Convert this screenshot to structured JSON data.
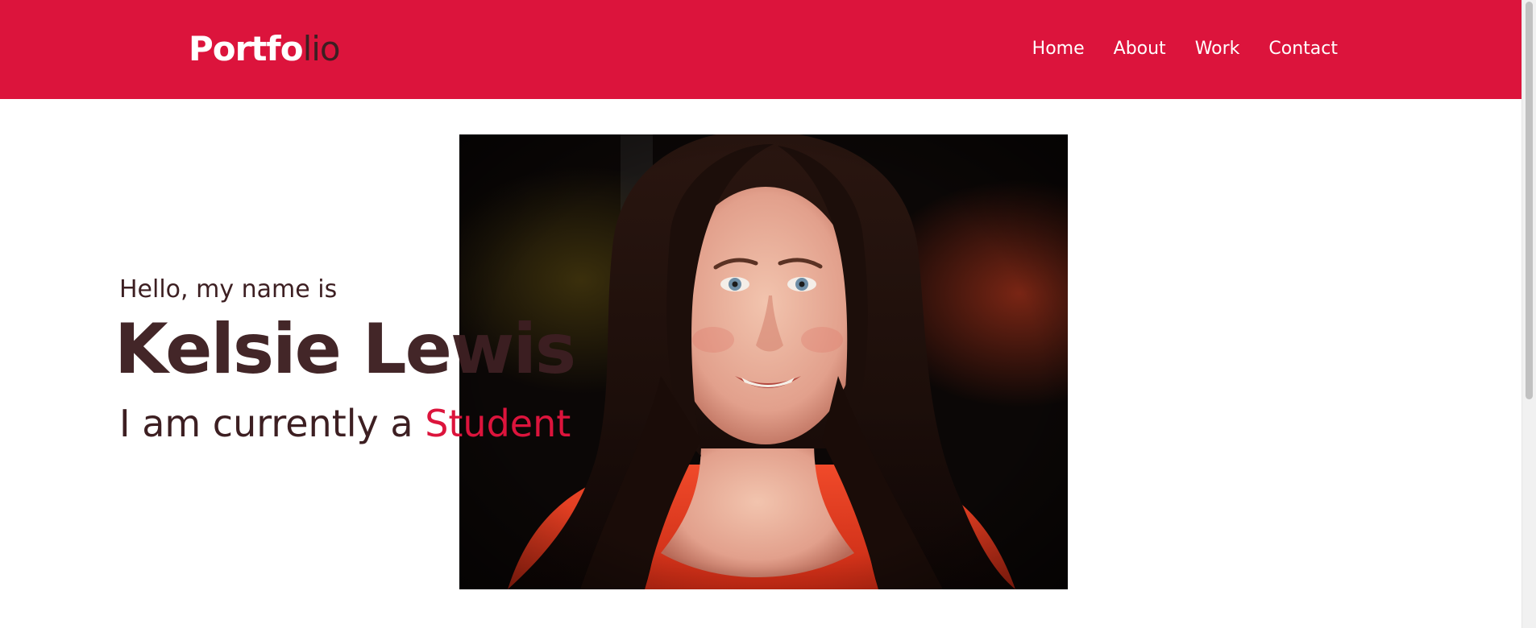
{
  "header": {
    "logo_part1": "Portfo",
    "logo_part2": "lio",
    "nav": [
      "Home",
      "About",
      "Work",
      "Contact"
    ]
  },
  "hero": {
    "intro": "Hello, my name is",
    "name": "Kelsie Lewis",
    "role_prefix": "I am currently a ",
    "role_highlight": "Student"
  },
  "colors": {
    "brand": "#dc143c",
    "text_dark": "#3d1f22",
    "background": "#ffffff"
  },
  "icons": [
    "profile-photo"
  ]
}
